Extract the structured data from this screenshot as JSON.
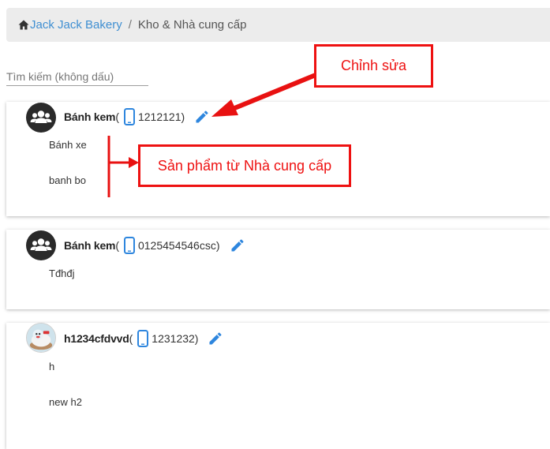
{
  "breadcrumb": {
    "home": "Jack Jack Bakery",
    "separator": "/",
    "current": "Kho & Nhà cung cấp"
  },
  "search": {
    "placeholder": "Tìm kiếm (không dấu)"
  },
  "suppliers": [
    {
      "name": "Bánh kem",
      "open_paren": "(",
      "phone": "1212121)",
      "avatar": "group-icon",
      "products": [
        "Bánh xe",
        "banh bo"
      ]
    },
    {
      "name": "Bánh kem",
      "open_paren": "(",
      "phone": "0125454546csc)",
      "avatar": "group-icon",
      "products": [
        "Tđhđj"
      ]
    },
    {
      "name": "h1234cfdvvd",
      "open_paren": "(",
      "phone": "1231232)",
      "avatar": "cake-photo",
      "products": [
        "h",
        "new h2"
      ]
    }
  ],
  "annotations": {
    "edit_label": "Chỉnh sửa",
    "products_label": "Sản phẩm từ Nhà cung cấp",
    "color": "#e81111"
  },
  "colors": {
    "accent": "#3f8fd2",
    "edit_icon": "#2e86de",
    "phone_icon": "#2e86de"
  }
}
